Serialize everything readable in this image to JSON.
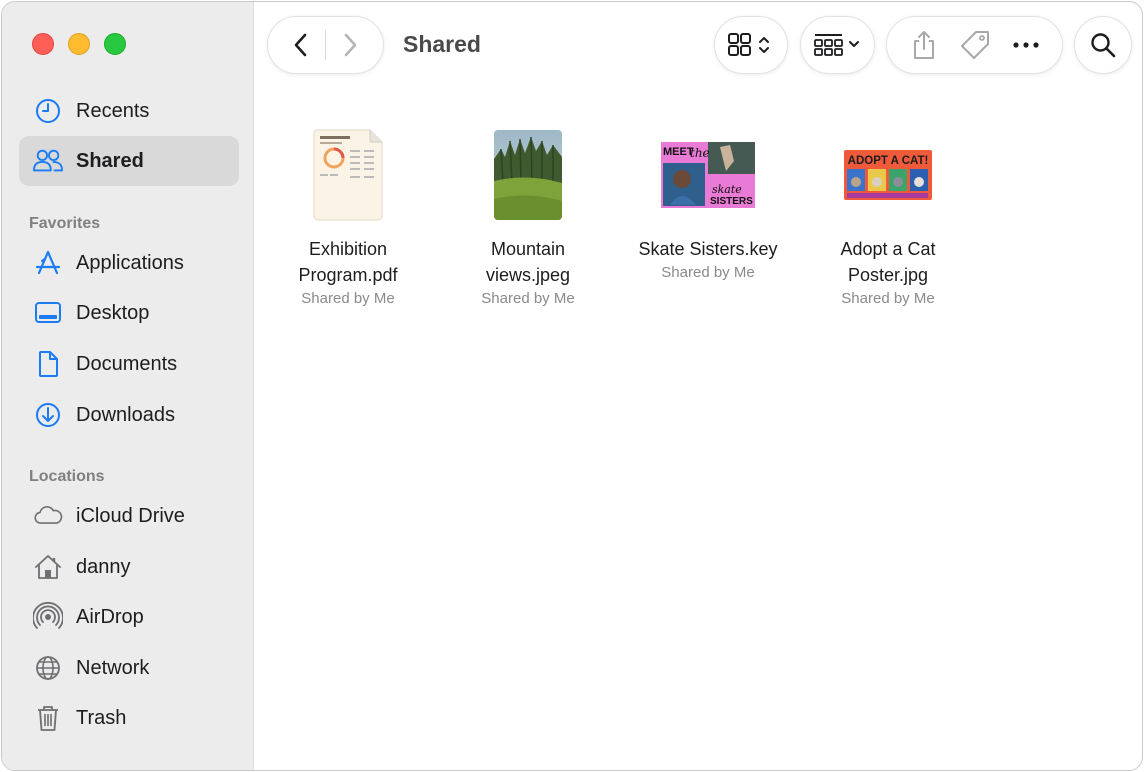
{
  "window": {
    "title": "Shared"
  },
  "sidebar": {
    "top_items": [
      {
        "label": "Recents",
        "icon": "clock-icon",
        "selected": false
      },
      {
        "label": "Shared",
        "icon": "people-icon",
        "selected": true
      }
    ],
    "favorites_header": "Favorites",
    "favorites": [
      {
        "label": "Applications",
        "icon": "applications-icon"
      },
      {
        "label": "Desktop",
        "icon": "desktop-icon"
      },
      {
        "label": "Documents",
        "icon": "document-icon"
      },
      {
        "label": "Downloads",
        "icon": "download-icon"
      }
    ],
    "locations_header": "Locations",
    "locations": [
      {
        "label": "iCloud Drive",
        "icon": "cloud-icon"
      },
      {
        "label": "danny",
        "icon": "home-icon"
      },
      {
        "label": "AirDrop",
        "icon": "airdrop-icon"
      },
      {
        "label": "Network",
        "icon": "globe-icon"
      },
      {
        "label": "Trash",
        "icon": "trash-icon"
      }
    ]
  },
  "toolbar": {
    "back": "chevron-left-icon",
    "forward": "chevron-right-icon",
    "view_mode": "grid-view-icon",
    "group_by": "group-icon",
    "share": "share-icon",
    "tag": "tag-icon",
    "more": "ellipsis-icon",
    "search": "search-icon"
  },
  "colors": {
    "accent": "#1a7cf5",
    "sidebar_bg": "#ececec",
    "selected_bg": "#d9d9d9"
  },
  "files": [
    {
      "name_line1": "Exhibition",
      "name_line2": "Program.pdf",
      "status": "Shared by Me"
    },
    {
      "name_line1": "Mountain",
      "name_line2": "views.jpeg",
      "status": "Shared by Me"
    },
    {
      "name_line1": "Skate Sisters.key",
      "name_line2": "",
      "status": "Shared by Me",
      "thumb_text1": "MEET",
      "thumb_text2": "the",
      "thumb_text3": "skate",
      "thumb_text4": "SISTERS"
    },
    {
      "name_line1": "Adopt a Cat",
      "name_line2": "Poster.jpg",
      "status": "Shared by Me",
      "thumb_text": "ADOPT A CAT!"
    }
  ]
}
